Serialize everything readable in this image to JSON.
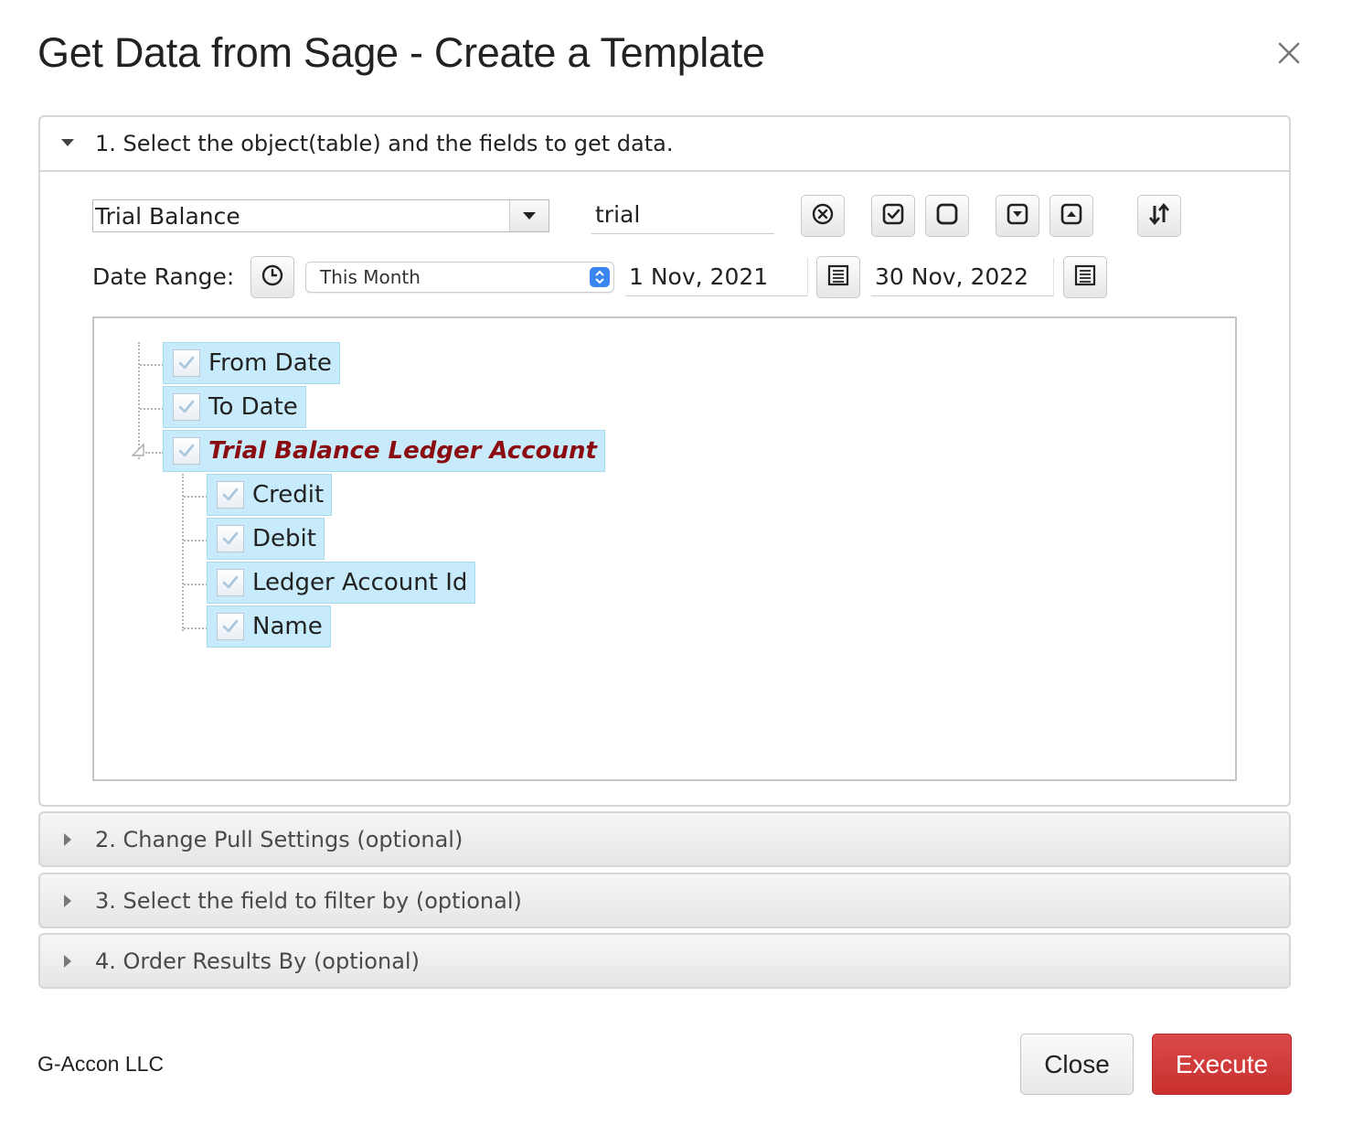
{
  "dialog": {
    "title": "Get Data from Sage - Create a Template",
    "close_icon": "close-icon"
  },
  "section1": {
    "label": "1. Select the object(table) and the fields to get data.",
    "expanded": true,
    "object_select": {
      "value": "Trial Balance"
    },
    "search": {
      "value": "trial"
    },
    "toolbar_icons": [
      "clear-search-icon",
      "check-all-icon",
      "uncheck-all-icon",
      "expand-all-icon",
      "collapse-all-icon",
      "sort-icon"
    ],
    "date_range": {
      "label": "Date Range:",
      "period": "This Month",
      "from": "1 Nov, 2021",
      "to": "30 Nov, 2022",
      "icons": [
        "clock-icon",
        "calendar-icon"
      ]
    },
    "tree": {
      "nodes": [
        {
          "label": "From Date",
          "checked": true
        },
        {
          "label": "To Date",
          "checked": true
        },
        {
          "label": "Trial Balance Ledger Account",
          "checked": true,
          "children": [
            {
              "label": "Credit",
              "checked": true
            },
            {
              "label": "Debit",
              "checked": true
            },
            {
              "label": "Ledger Account Id",
              "checked": true
            },
            {
              "label": "Name",
              "checked": true
            }
          ]
        }
      ]
    }
  },
  "section2": {
    "label": "2. Change Pull Settings (optional)",
    "expanded": false
  },
  "section3": {
    "label": "3. Select the field to filter by (optional)",
    "expanded": false
  },
  "section4": {
    "label": "4. Order Results By (optional)",
    "expanded": false
  },
  "footer": {
    "company": "G-Accon LLC",
    "close_label": "Close",
    "execute_label": "Execute"
  },
  "colors": {
    "execute_button": "#cd3a3a",
    "tree_node_highlight": "#c7ebfb",
    "parent_node_text": "#8b0c10",
    "select_spinner": "#3a86f0"
  }
}
